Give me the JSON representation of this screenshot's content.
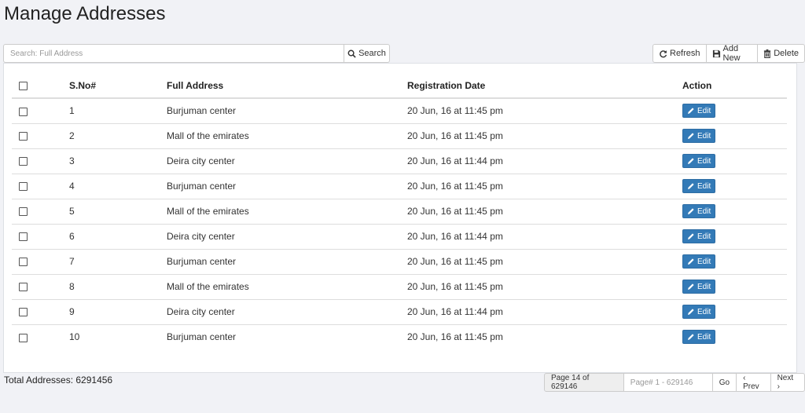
{
  "page_title": "Manage Addresses",
  "search": {
    "placeholder": "Search: Full Address",
    "value": "",
    "button_label": "Search"
  },
  "toolbar": {
    "refresh_label": "Refresh",
    "add_new_label": "Add New",
    "delete_label": "Delete"
  },
  "table": {
    "headers": {
      "sno": "S.No#",
      "address": "Full Address",
      "date": "Registration Date",
      "action": "Action"
    },
    "edit_label": "Edit",
    "rows": [
      {
        "sno": "1",
        "address": "Burjuman center",
        "date": "20 Jun, 16 at 11:45 pm"
      },
      {
        "sno": "2",
        "address": "Mall of the emirates",
        "date": "20 Jun, 16 at 11:45 pm"
      },
      {
        "sno": "3",
        "address": "Deira city center",
        "date": "20 Jun, 16 at 11:44 pm"
      },
      {
        "sno": "4",
        "address": "Burjuman center",
        "date": "20 Jun, 16 at 11:45 pm"
      },
      {
        "sno": "5",
        "address": "Mall of the emirates",
        "date": "20 Jun, 16 at 11:45 pm"
      },
      {
        "sno": "6",
        "address": "Deira city center",
        "date": "20 Jun, 16 at 11:44 pm"
      },
      {
        "sno": "7",
        "address": "Burjuman center",
        "date": "20 Jun, 16 at 11:45 pm"
      },
      {
        "sno": "8",
        "address": "Mall of the emirates",
        "date": "20 Jun, 16 at 11:45 pm"
      },
      {
        "sno": "9",
        "address": "Deira city center",
        "date": "20 Jun, 16 at 11:44 pm"
      },
      {
        "sno": "10",
        "address": "Burjuman center",
        "date": "20 Jun, 16 at 11:45 pm"
      }
    ]
  },
  "footer": {
    "total_label": "Total Addresses: 6291456",
    "page_info": "Page 14 of 629146",
    "page_input_placeholder": "Page# 1 - 629146",
    "go_label": "Go",
    "prev_label": "‹ Prev",
    "next_label": "Next ›"
  },
  "colors": {
    "primary": "#337ab7",
    "background": "#f1f2f6"
  }
}
